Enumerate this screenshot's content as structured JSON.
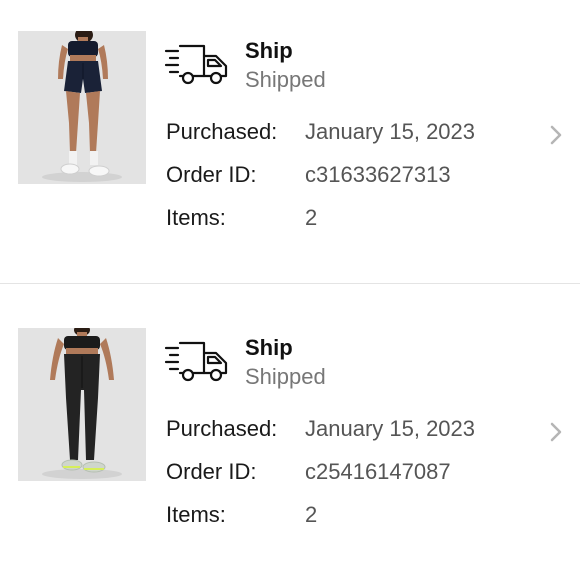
{
  "orders": [
    {
      "product_image": "high-rise-shorts-navy",
      "method": "Ship",
      "status": "Shipped",
      "purchased_label": "Purchased:",
      "purchased_value": "January 15, 2023",
      "order_id_label": "Order ID:",
      "order_id_value": "c31633627313",
      "items_label": "Items:",
      "items_value": "2"
    },
    {
      "product_image": "high-rise-leggings-black",
      "method": "Ship",
      "status": "Shipped",
      "purchased_label": "Purchased:",
      "purchased_value": "January 15, 2023",
      "order_id_label": "Order ID:",
      "order_id_value": "c25416147087",
      "items_label": "Items:",
      "items_value": "2"
    }
  ],
  "icons": {
    "shipping": "delivery-truck-icon",
    "chevron": "chevron-right-icon"
  },
  "colors": {
    "background": "#ffffff",
    "status_text": "#777777",
    "value_text": "#555555",
    "chevron": "#b5b5b5",
    "divider": "#e4e4e4",
    "thumbnail_bg": "#e2e2e2"
  }
}
